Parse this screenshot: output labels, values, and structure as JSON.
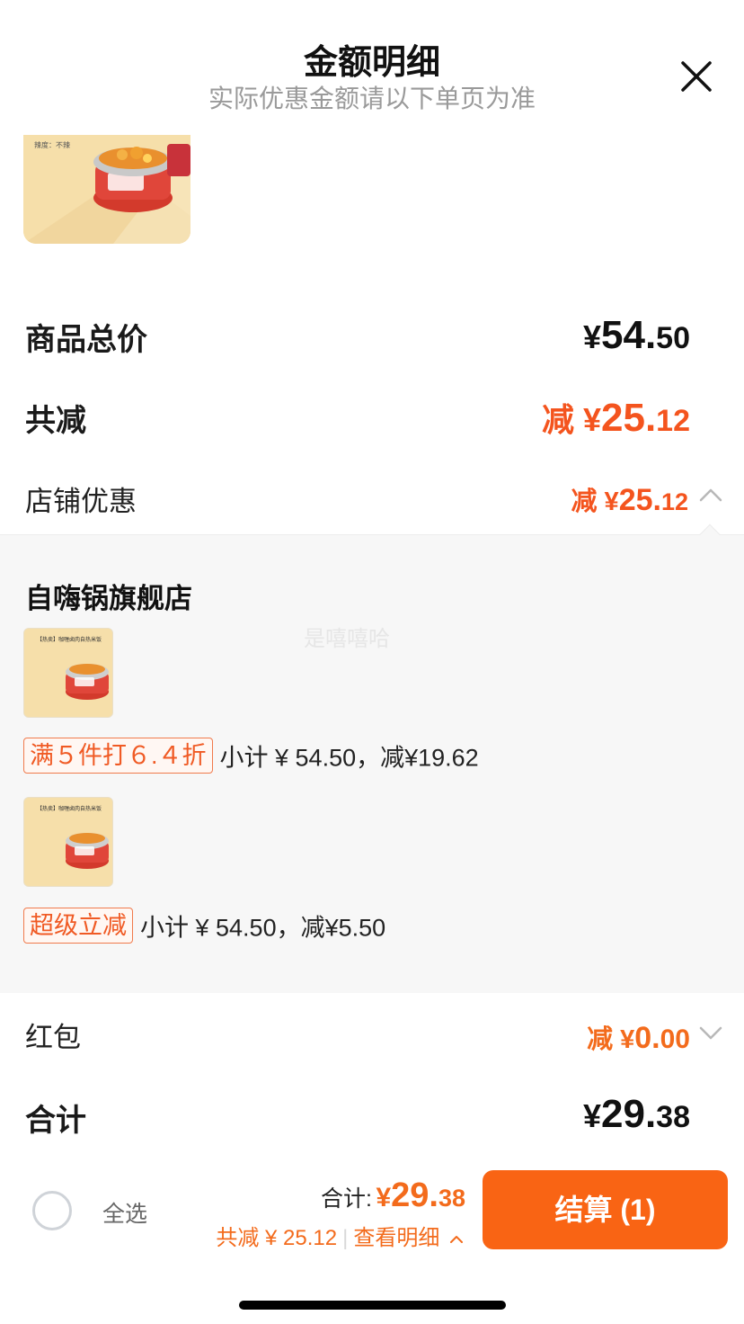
{
  "header": {
    "title": "金额明细",
    "subtitle": "实际优惠金额请以下单页为准"
  },
  "top_product": {
    "spice_text": "辣度：不辣"
  },
  "summary": {
    "goods_total_label": "商品总价",
    "goods_total_yen": "¥",
    "goods_total_int": "54.",
    "goods_total_dec": "50",
    "total_discount_label": "共减",
    "total_discount_prefix": "减 ¥",
    "total_discount_int": "25.",
    "total_discount_dec": "12",
    "shop_discount_label": "店铺优惠",
    "shop_discount_prefix": "减 ¥",
    "shop_discount_int": "25.",
    "shop_discount_dec": "12"
  },
  "shop": {
    "name": "自嗨锅旗舰店",
    "watermark": "是嘻嘻哈",
    "items": [
      {
        "thumb_title": "【热卖】咖喱卤肉自热米饭",
        "tag": "满５件打６.４折",
        "text": "小计 ¥ 54.50，减¥19.62"
      },
      {
        "thumb_title": "【热卖】咖喱卤肉自热米饭",
        "tag": "超级立减",
        "text": "小计 ¥ 54.50，减¥5.50"
      }
    ]
  },
  "red_packet": {
    "label": "红包",
    "prefix": "减 ¥",
    "int": "0.",
    "dec": "00"
  },
  "grand_total": {
    "label": "合计",
    "yen": "¥",
    "int": "29.",
    "dec": "38"
  },
  "bottom_bar": {
    "select_all": "全选",
    "total_label": "合计:",
    "total_yen": "¥",
    "total_int": "29.",
    "total_dec": "38",
    "saved_text": "共减 ¥ 25.12",
    "view_detail": "查看明细",
    "checkout_label": "结算 (1)"
  },
  "colors": {
    "accent": "#f96414",
    "discount": "#f4541e",
    "panel_bg": "#f7f7f7"
  }
}
